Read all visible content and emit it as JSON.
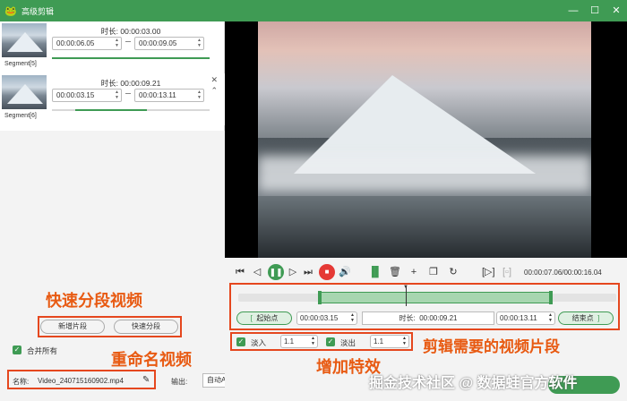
{
  "window": {
    "title": "高级剪辑",
    "minimize": "—",
    "maximize": "☐",
    "close": "✕"
  },
  "segments": [
    {
      "label": "Segment[5]",
      "duration_label": "时长:",
      "duration": "00:00:03.00",
      "start": "00:00:06.05",
      "end": "00:00:09.05",
      "progress": 1.0
    },
    {
      "label": "Segment[6]",
      "duration_label": "时长:",
      "duration": "00:00:09.21",
      "start": "00:00:03.15",
      "end": "00:00:13.11",
      "progress": 0.6
    }
  ],
  "left_controls": {
    "add_segment": "新增片段",
    "quick_split": "快速分段",
    "merge_all": "合并所有",
    "name_label": "名称:",
    "file_name": "Video_240715160902.mp4",
    "output_label": "输出:",
    "output_value": "自动Auto"
  },
  "annotations": {
    "quick_split_video": "快速分段视频",
    "rename_video": "重命名视频",
    "add_effects": "增加特效",
    "clip_segment": "剪辑需要的视频片段"
  },
  "player": {
    "time_display": "00:00:07.06/00:00:16.04"
  },
  "clip": {
    "start_btn": "起始点",
    "start_time": "00:00:03.15",
    "duration_label": "时长:",
    "duration": "00:00:09.21",
    "end_time": "00:00:13.11",
    "end_btn": "结束点"
  },
  "effects": {
    "fade_in_label": "淡入",
    "fade_in_value": "1.1",
    "fade_out_label": "淡出",
    "fade_out_value": "1.1"
  },
  "watermark": "掘金技术社区 @ 数据蛙官方软件",
  "colors": {
    "accent": "#3f9b54",
    "annotation": "#e85a12",
    "stop": "#e53935"
  }
}
